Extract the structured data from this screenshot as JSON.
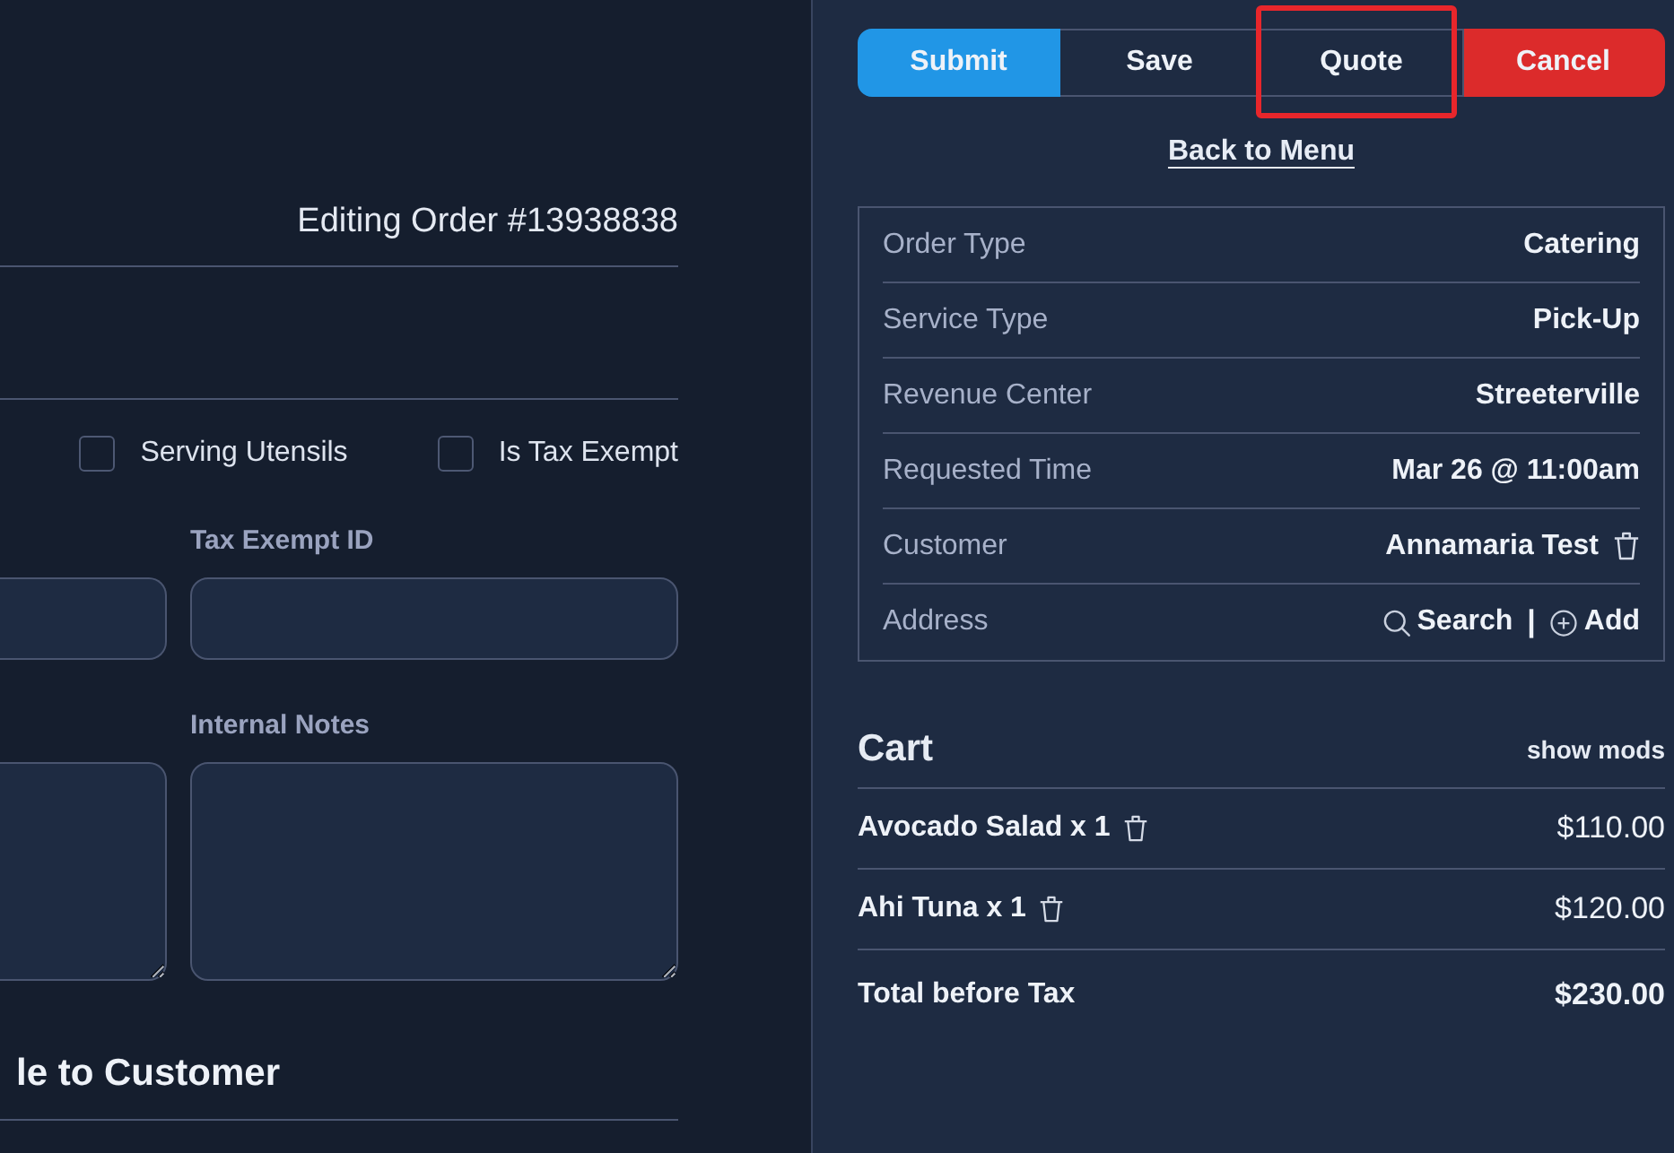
{
  "order_header": {
    "title": "Editing Order #13938838"
  },
  "options": [
    {
      "label": "Serving Utensils",
      "checked": false
    },
    {
      "label": "Is Tax Exempt",
      "checked": false
    }
  ],
  "fields": [
    {
      "kind": "input"
    },
    {
      "kind": "input",
      "label": "Tax Exempt ID"
    },
    {
      "kind": "textarea"
    },
    {
      "kind": "textarea",
      "label": "Internal Notes"
    }
  ],
  "section_heading": "le to Customer",
  "actions": [
    {
      "label": "Submit",
      "kind": "primary",
      "highlighted": false
    },
    {
      "label": "Save",
      "kind": "plain",
      "highlighted": false
    },
    {
      "label": "Quote",
      "kind": "plain",
      "highlighted": true
    },
    {
      "label": "Cancel",
      "kind": "danger",
      "highlighted": false
    }
  ],
  "back_link": "Back to Menu",
  "details": [
    {
      "label": "Order Type",
      "kind": "text",
      "value": "Catering"
    },
    {
      "label": "Service Type",
      "kind": "text",
      "value": "Pick-Up"
    },
    {
      "label": "Revenue Center",
      "kind": "text",
      "value": "Streeterville"
    },
    {
      "label": "Requested Time",
      "kind": "text",
      "value": "Mar 26 @ 11:00am"
    },
    {
      "label": "Customer",
      "kind": "customer",
      "value": "Annamaria Test"
    },
    {
      "label": "Address",
      "kind": "links",
      "links": [
        {
          "kind": "search",
          "label": "Search"
        },
        {
          "kind": "add",
          "label": "Add"
        }
      ],
      "separator": "|"
    }
  ],
  "cart": {
    "title": "Cart",
    "toggle": "show mods",
    "items": [
      {
        "name": "Avocado Salad x 1",
        "price": "$110.00"
      },
      {
        "name": "Ahi Tuna x 1",
        "price": "$120.00"
      }
    ],
    "total": {
      "label": "Total before Tax",
      "amount": "$230.00"
    }
  }
}
